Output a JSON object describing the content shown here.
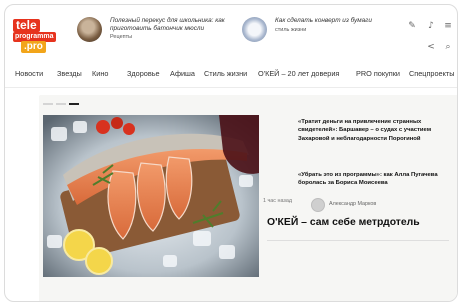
{
  "logo": {
    "line1": "tele",
    "line2": "programma",
    "line3": ".pro"
  },
  "teasers": [
    {
      "text": "Полезный перекус для школьника: как приготовить батончик мюсли",
      "rubric": "Рецепты"
    },
    {
      "text": "Как сделать конверт из бумаги",
      "rubric": "стиль жизни"
    }
  ],
  "header_icons": {
    "icon1": "✎",
    "icon2": "♪",
    "icon3": "≡",
    "icon4": "<",
    "icon5": "⌕"
  },
  "nav": [
    "Новости",
    "Звезды",
    "Кино",
    "Здоровье",
    "Афиша",
    "Стиль жизни",
    "О'КЕЙ – 20 лет доверия",
    "PRO покупки",
    "Спецпроекты"
  ],
  "side_news": [
    "«Тратит деньги на привлечение странных свидетелей»: Баршавер – о судах с участием Захаровой и неблагодарности Порогиной",
    "«Убрать это из программы»: как Алла Пугачева боролась за Бориса Моисеева"
  ],
  "featured": {
    "time": "1 час назад",
    "author": "Александр Марков",
    "title": "О'КЕЙ – сам себе метрдотель"
  },
  "colors": {
    "brand_red": "#e6331e",
    "brand_orange": "#f2a51a",
    "panel_bg": "#f6f6f4"
  }
}
